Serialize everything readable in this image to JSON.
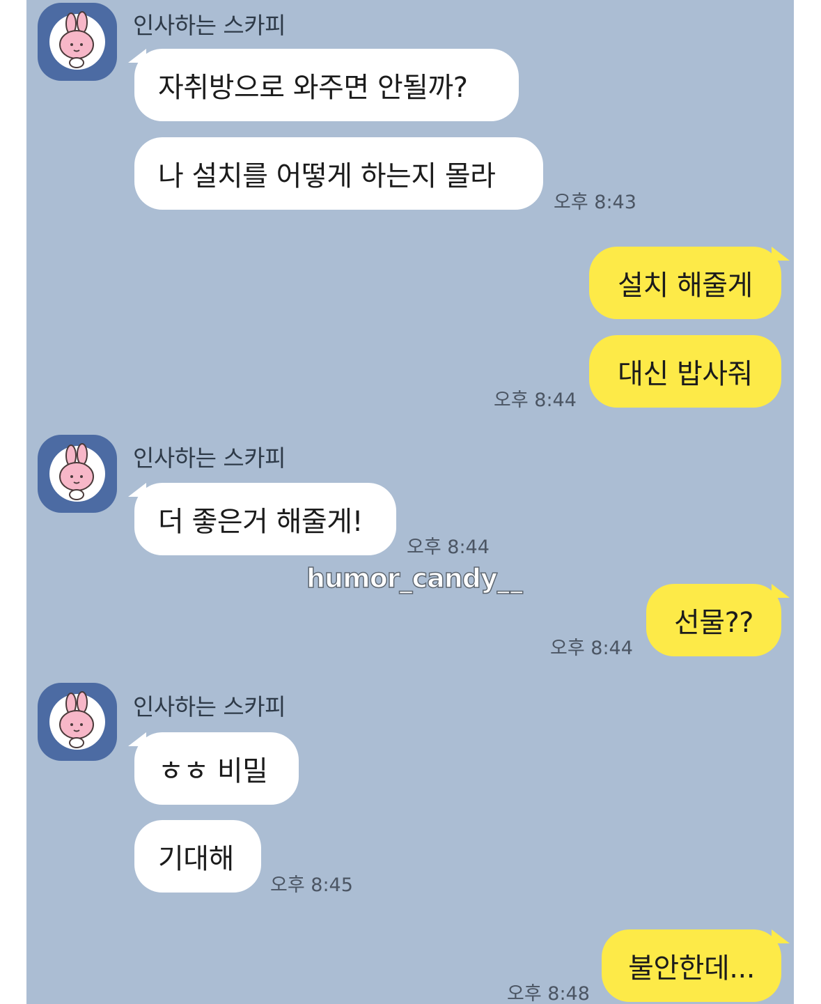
{
  "chat": {
    "sender_name": "인사하는 스카피",
    "watermark": "humor_candy__",
    "colors": {
      "background": "#abbdd3",
      "incoming_bubble": "#ffffff",
      "outgoing_bubble": "#fdea48",
      "avatar_background": "#4c6ba3"
    },
    "messages": [
      {
        "direction": "incoming",
        "text": "자취방으로 와주면 안될까?"
      },
      {
        "direction": "incoming",
        "text": "나 설치를 어떻게 하는지 몰라",
        "time": "오후 8:43"
      },
      {
        "direction": "outgoing",
        "text": "설치 해줄게"
      },
      {
        "direction": "outgoing",
        "text": "대신 밥사줘",
        "time": "오후 8:44"
      },
      {
        "direction": "incoming",
        "text": "더 좋은거 해줄게!",
        "time": "오후 8:44"
      },
      {
        "direction": "outgoing",
        "text": "선물??",
        "time": "오후 8:44"
      },
      {
        "direction": "incoming",
        "text": "ㅎㅎ 비밀"
      },
      {
        "direction": "incoming",
        "text": "기대해",
        "time": "오후 8:45"
      },
      {
        "direction": "outgoing",
        "text": "불안한데...",
        "time": "오후 8:48"
      }
    ]
  }
}
